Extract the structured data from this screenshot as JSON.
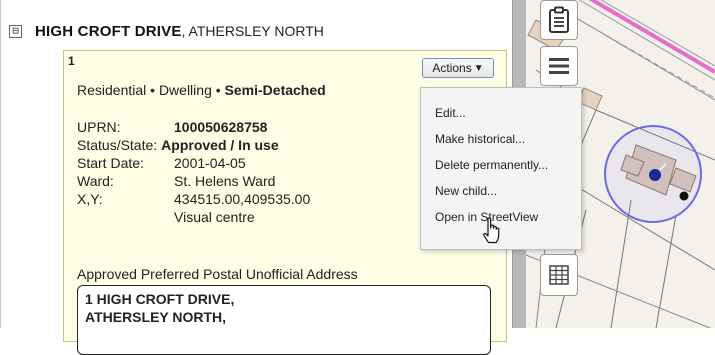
{
  "street": {
    "name": "HIGH CROFT DRIVE",
    "locality": ", ATHERSLEY NORTH",
    "toggle": "⊟"
  },
  "record": {
    "number": "1",
    "classification_prefix": "Residential • Dwelling • ",
    "classification_type": "Semi-Detached",
    "uprn_label": "UPRN:",
    "uprn_value": "100050628758",
    "status_label": "Status/State:",
    "status_value": "Approved / In use",
    "start_label": "Start Date:",
    "start_value": "2001-04-05",
    "ward_label": "Ward:",
    "ward_value": "St. Helens Ward",
    "xy_label": "X,Y:",
    "xy_value": "434515.00,409535.00",
    "xy_note": "Visual centre",
    "address_label": "Approved Preferred Postal Unofficial Address",
    "address_line1": "1 HIGH CROFT DRIVE,",
    "address_line2": "ATHERSLEY NORTH,"
  },
  "actions": {
    "button_label": "Actions",
    "caret": "▼",
    "menu": [
      "Edit...",
      "Make historical...",
      "Delete permanently...",
      "New child...",
      "Open in StreetView"
    ]
  },
  "map_toolbar": {
    "icons": [
      "clipboard-icon",
      "menu-icon",
      "grid-icon"
    ]
  },
  "colors": {
    "card_bg": "#fefde6",
    "card_border": "#c9c07a",
    "road_pink": "#e36fc8",
    "highlight_circle": "#5a5ae0",
    "marker": "#1a2a9c"
  }
}
